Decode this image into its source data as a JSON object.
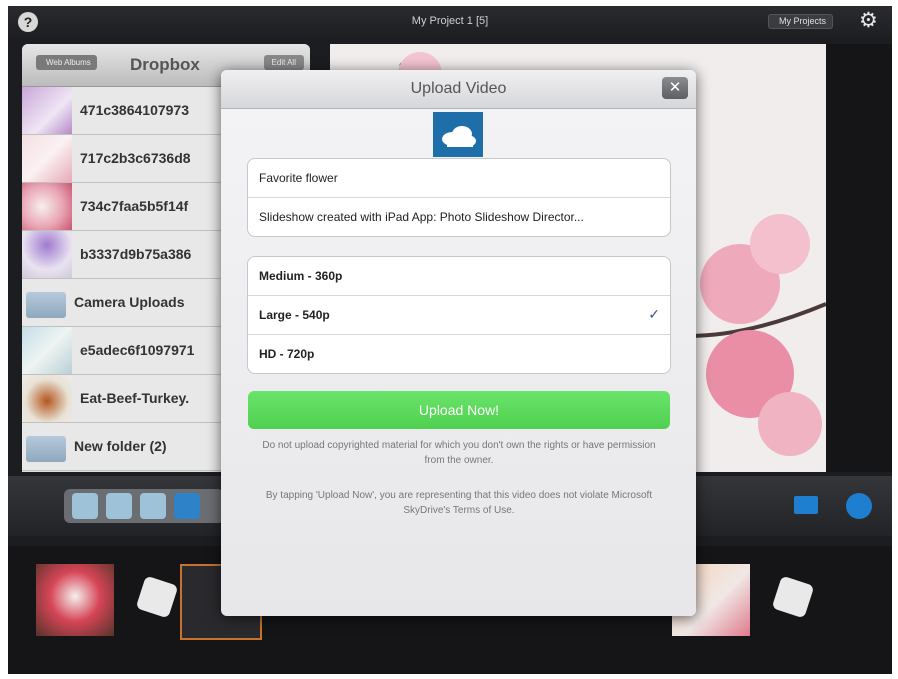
{
  "topbar": {
    "help_glyph": "?",
    "title": "My Project 1  [5]",
    "my_projects_label": "My Projects",
    "gear_icon": "gear-icon"
  },
  "browser": {
    "back_label": "Web Albums",
    "title": "Dropbox",
    "edit_label": "Edit All",
    "items": [
      {
        "label": "471c3864107973",
        "type": "photo"
      },
      {
        "label": "717c2b3c6736d8",
        "type": "photo"
      },
      {
        "label": "734c7faa5b5f14f",
        "type": "photo"
      },
      {
        "label": "b3337d9b75a386",
        "type": "photo"
      },
      {
        "label": "Camera Uploads",
        "type": "folder"
      },
      {
        "label": "e5adec6f1097971",
        "type": "photo"
      },
      {
        "label": "Eat-Beef-Turkey.",
        "type": "photo"
      },
      {
        "label": "New folder (2)",
        "type": "folder"
      }
    ]
  },
  "dialog": {
    "title": "Upload Video",
    "close_glyph": "✕",
    "video_title": "Favorite flower",
    "video_description": "Slideshow created with iPad App: Photo Slideshow Director...",
    "quality_options": [
      {
        "label": "Medium - 360p",
        "selected": false
      },
      {
        "label": "Large - 540p",
        "selected": true
      },
      {
        "label": "HD - 720p",
        "selected": false
      }
    ],
    "check_glyph": "✓",
    "upload_label": "Upload Now!",
    "notice_1": "Do not upload copyrighted material for which you don't own the rights or have permission from the owner.",
    "notice_2": "By tapping 'Upload Now', you are representing that this video does not violate Microsoft SkyDrive's Terms of Use."
  },
  "colors": {
    "accent_green": "#55d655",
    "skydrive_blue": "#1e6eaa",
    "toolbar_blue": "#1e7fd0"
  }
}
